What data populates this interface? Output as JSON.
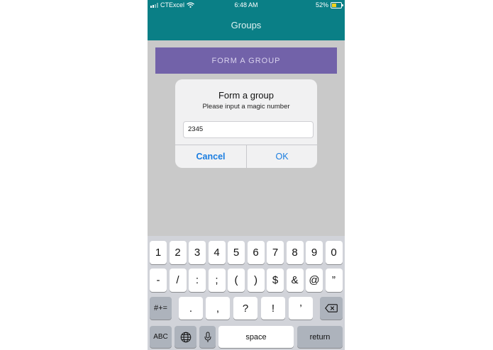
{
  "status_bar": {
    "carrier": "CTExcel",
    "time": "6:48 AM",
    "battery": "52%",
    "battery_level": 0.52
  },
  "nav": {
    "title": "Groups"
  },
  "main": {
    "form_group_button": "FORM A GROUP"
  },
  "dialog": {
    "title": "Form a group",
    "message": "Please input a magic number",
    "input_value": "2345",
    "cancel_label": "Cancel",
    "ok_label": "OK"
  },
  "keyboard": {
    "row1": [
      "1",
      "2",
      "3",
      "4",
      "5",
      "6",
      "7",
      "8",
      "9",
      "0"
    ],
    "row2": [
      "-",
      "/",
      ":",
      ";",
      "(",
      ")",
      "$",
      "&",
      "@",
      "”"
    ],
    "row3": [
      ".",
      ",",
      "?",
      "!",
      "’"
    ],
    "symbols_label": "#+=",
    "abc_label": "ABC",
    "space_label": "space",
    "return_label": "return"
  },
  "colors": {
    "accent": "#0a7f86",
    "button": "#7262a9",
    "link": "#1a7de0"
  }
}
